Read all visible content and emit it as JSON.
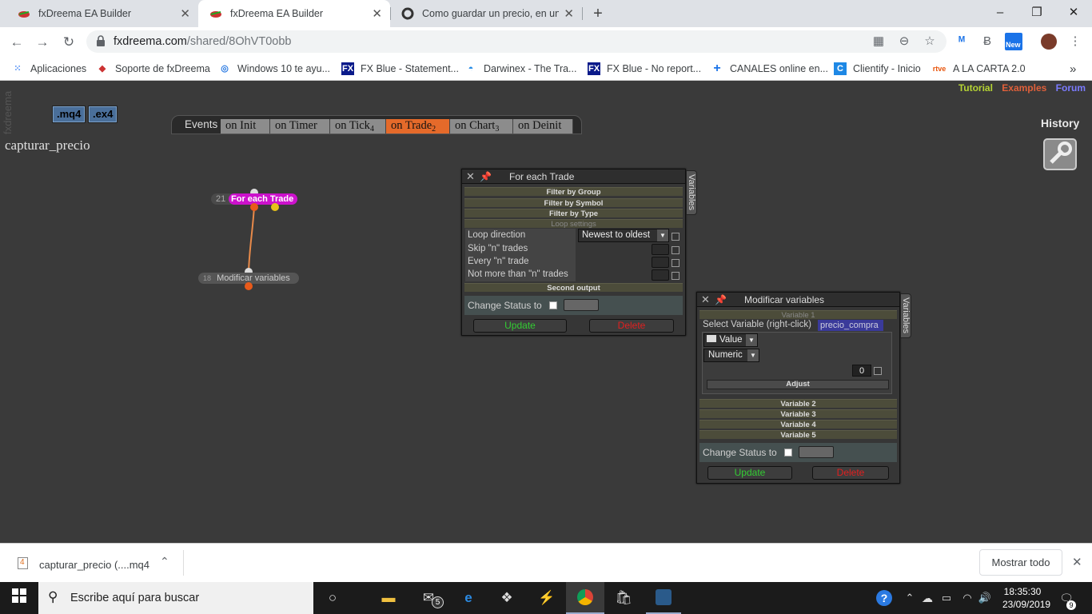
{
  "browser": {
    "tabs": [
      {
        "title": "fxDreema EA Builder",
        "active": false
      },
      {
        "title": "fxDreema EA Builder",
        "active": true
      },
      {
        "title": "Como guardar un precio, en una",
        "active": false
      }
    ],
    "new_tab": "+",
    "window_controls": {
      "minimize": "–",
      "maximize": "❐",
      "close": "✕"
    },
    "url_host": "fxdreema.com",
    "url_path": "/shared/8OhVT0obb",
    "extensions": {
      "new_badge": "New"
    }
  },
  "bookmarks": [
    {
      "label": "Aplicaciones",
      "icon": "apps-grid-icon"
    },
    {
      "label": "Soporte de fxDreema",
      "icon": "fxdreema-icon"
    },
    {
      "label": "Windows 10 te ayu...",
      "icon": "windows-icon"
    },
    {
      "label": "FX Blue - Statement...",
      "icon": "fxblue-icon"
    },
    {
      "label": "Darwinex - The Tra...",
      "icon": "darwinex-icon"
    },
    {
      "label": "FX Blue - No report...",
      "icon": "fxblue-icon"
    },
    {
      "label": "CANALES online en...",
      "icon": "plus-icon"
    },
    {
      "label": "Clientify - Inicio",
      "icon": "clientify-icon"
    },
    {
      "label": "A LA CARTA 2.0",
      "icon": "rtve-icon"
    }
  ],
  "app": {
    "side_watermark": "fxdreema",
    "file_buttons": [
      ".mq4",
      ".ex4"
    ],
    "top_links": [
      "Tutorial",
      "Examples",
      "Forum"
    ],
    "events_label": "Events",
    "event_tabs": [
      {
        "label": "on Init",
        "count": ""
      },
      {
        "label": "on Timer",
        "count": ""
      },
      {
        "label": "on Tick",
        "count": "4"
      },
      {
        "label": "on Trade",
        "count": "2"
      },
      {
        "label": "on Chart",
        "count": "3"
      },
      {
        "label": "on Deinit",
        "count": ""
      }
    ],
    "active_event": "on Trade",
    "history": "History",
    "project_title": "capturar_precio",
    "nodes": [
      {
        "id": "21",
        "label": "For each Trade"
      },
      {
        "id": "18",
        "label": "Modificar variables"
      }
    ]
  },
  "for_each_panel": {
    "title": "For each Trade",
    "side_tab": "Variables",
    "sections": [
      "Filter by Group",
      "Filter by Symbol",
      "Filter by Type",
      "Loop settings"
    ],
    "rows": [
      {
        "label": "Loop direction",
        "value": "Newest to oldest"
      },
      {
        "label": "Skip \"n\" trades",
        "value": ""
      },
      {
        "label": "Every \"n\" trade",
        "value": ""
      },
      {
        "label": "Not more than \"n\" trades",
        "value": ""
      }
    ],
    "second_output": "Second output",
    "change_status": "Change Status to",
    "update": "Update",
    "delete": "Delete"
  },
  "modify_panel": {
    "title": "Modificar variables",
    "side_tab": "Variables",
    "variable1_header": "Variable 1",
    "select_label": "Select Variable (right-click)",
    "selected_variable": "precio_compra",
    "value_mode": "Value",
    "value_type": "Numeric",
    "value": "0",
    "adjust": "Adjust",
    "other_variables": [
      "Variable 2",
      "Variable 3",
      "Variable 4",
      "Variable 5"
    ],
    "change_status": "Change Status to",
    "update": "Update",
    "delete": "Delete"
  },
  "download_bar": {
    "file": "capturar_precio (....mq4",
    "show_all": "Mostrar todo"
  },
  "taskbar": {
    "search_placeholder": "Escribe aquí para buscar",
    "mail_badge": "5",
    "time": "18:35:30",
    "date": "23/09/2019",
    "notifications": "9"
  },
  "colors": {
    "active_event": "#e56a2a",
    "node_magenta": "#cc11cc",
    "update_green": "#33cc33",
    "delete_red": "#e02020",
    "tutorial": "#b5d334",
    "examples": "#e0603a",
    "forum": "#7b7bff"
  }
}
